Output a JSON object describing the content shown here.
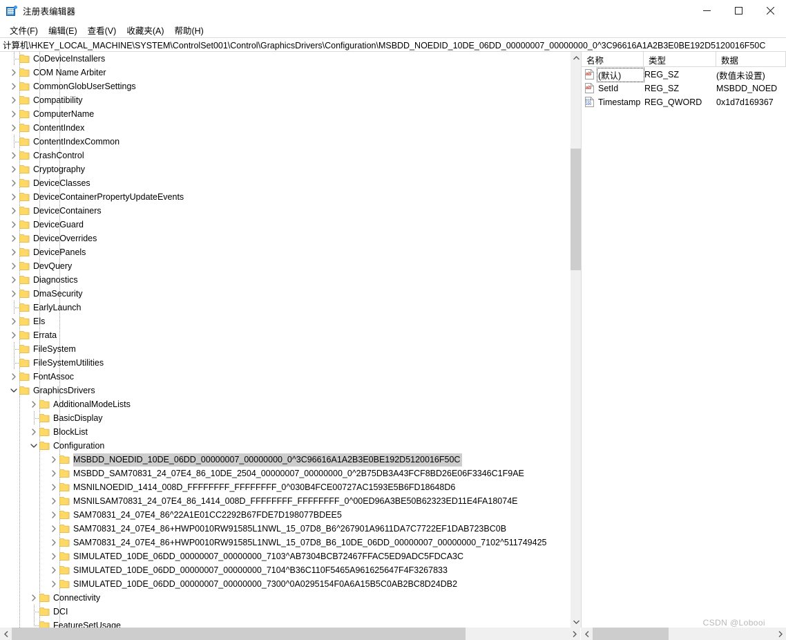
{
  "window": {
    "title": "注册表编辑器",
    "icon": "registry-editor-icon",
    "controls": {
      "minimize": "minimize-icon",
      "maximize": "maximize-icon",
      "close": "close-icon"
    }
  },
  "menubar": [
    {
      "text": "文件(F)",
      "accel": "F"
    },
    {
      "text": "编辑(E)",
      "accel": "E"
    },
    {
      "text": "查看(V)",
      "accel": "V"
    },
    {
      "text": "收藏夹(A)",
      "accel": "A"
    },
    {
      "text": "帮助(H)",
      "accel": "H"
    }
  ],
  "address": {
    "path": "计算机\\HKEY_LOCAL_MACHINE\\SYSTEM\\ControlSet001\\Control\\GraphicsDrivers\\Configuration\\MSBDD_NOEDID_10DE_06DD_00000007_00000000_0^3C96616A1A2B3E0BE192D5120016F50C"
  },
  "tree": {
    "rows": [
      {
        "label": "CoDeviceInstallers",
        "indent": 3,
        "state": "leaf"
      },
      {
        "label": "COM Name Arbiter",
        "indent": 3,
        "state": "collapsed"
      },
      {
        "label": "CommonGlobUserSettings",
        "indent": 3,
        "state": "collapsed"
      },
      {
        "label": "Compatibility",
        "indent": 3,
        "state": "collapsed"
      },
      {
        "label": "ComputerName",
        "indent": 3,
        "state": "collapsed"
      },
      {
        "label": "ContentIndex",
        "indent": 3,
        "state": "collapsed"
      },
      {
        "label": "ContentIndexCommon",
        "indent": 3,
        "state": "leaf"
      },
      {
        "label": "CrashControl",
        "indent": 3,
        "state": "collapsed"
      },
      {
        "label": "Cryptography",
        "indent": 3,
        "state": "collapsed"
      },
      {
        "label": "DeviceClasses",
        "indent": 3,
        "state": "collapsed"
      },
      {
        "label": "DeviceContainerPropertyUpdateEvents",
        "indent": 3,
        "state": "collapsed"
      },
      {
        "label": "DeviceContainers",
        "indent": 3,
        "state": "collapsed"
      },
      {
        "label": "DeviceGuard",
        "indent": 3,
        "state": "collapsed"
      },
      {
        "label": "DeviceOverrides",
        "indent": 3,
        "state": "collapsed"
      },
      {
        "label": "DevicePanels",
        "indent": 3,
        "state": "collapsed"
      },
      {
        "label": "DevQuery",
        "indent": 3,
        "state": "collapsed"
      },
      {
        "label": "Diagnostics",
        "indent": 3,
        "state": "collapsed"
      },
      {
        "label": "DmaSecurity",
        "indent": 3,
        "state": "collapsed"
      },
      {
        "label": "EarlyLaunch",
        "indent": 3,
        "state": "leaf"
      },
      {
        "label": "Els",
        "indent": 3,
        "state": "collapsed"
      },
      {
        "label": "Errata",
        "indent": 3,
        "state": "collapsed"
      },
      {
        "label": "FileSystem",
        "indent": 3,
        "state": "leaf"
      },
      {
        "label": "FileSystemUtilities",
        "indent": 3,
        "state": "leaf"
      },
      {
        "label": "FontAssoc",
        "indent": 3,
        "state": "collapsed"
      },
      {
        "label": "GraphicsDrivers",
        "indent": 3,
        "state": "expanded"
      },
      {
        "label": "AdditionalModeLists",
        "indent": 4,
        "state": "collapsed"
      },
      {
        "label": "BasicDisplay",
        "indent": 4,
        "state": "leaf"
      },
      {
        "label": "BlockList",
        "indent": 4,
        "state": "collapsed"
      },
      {
        "label": "Configuration",
        "indent": 4,
        "state": "expanded"
      },
      {
        "label": "MSBDD_NOEDID_10DE_06DD_00000007_00000000_0^3C96616A1A2B3E0BE192D5120016F50C",
        "indent": 5,
        "state": "collapsed",
        "selected": true
      },
      {
        "label": "MSBDD_SAM70831_24_07E4_86_10DE_2504_00000007_00000000_0^2B75DB3A43FCF8BD26E06F3346C1F9AE",
        "indent": 5,
        "state": "collapsed"
      },
      {
        "label": "MSNILNOEDID_1414_008D_FFFFFFFF_FFFFFFFF_0^030B4FCE00727AC1593E5B6FD18648D6",
        "indent": 5,
        "state": "collapsed"
      },
      {
        "label": "MSNILSAM70831_24_07E4_86_1414_008D_FFFFFFFF_FFFFFFFF_0^00ED96A3BE50B62323ED11E4FA18074E",
        "indent": 5,
        "state": "collapsed"
      },
      {
        "label": "SAM70831_24_07E4_86^22A1E01CC2292B67FDE7D198077BDEE5",
        "indent": 5,
        "state": "collapsed"
      },
      {
        "label": "SAM70831_24_07E4_86+HWP0010RW91585L1NWL_15_07D8_B6^267901A9611DA7C7722EF1DAB723BC0B",
        "indent": 5,
        "state": "collapsed"
      },
      {
        "label": "SAM70831_24_07E4_86+HWP0010RW91585L1NWL_15_07D8_B6_10DE_06DD_00000007_00000000_7102^511749425",
        "indent": 5,
        "state": "collapsed"
      },
      {
        "label": "SIMULATED_10DE_06DD_00000007_00000000_7103^AB7304BCB72467FFAC5ED9ADC5FDCA3C",
        "indent": 5,
        "state": "collapsed"
      },
      {
        "label": "SIMULATED_10DE_06DD_00000007_00000000_7104^B36C110F5465A961625647F4F3267833",
        "indent": 5,
        "state": "collapsed"
      },
      {
        "label": "SIMULATED_10DE_06DD_00000007_00000000_7300^0A0295154F0A6A15B5C0AB2BC8D24DB2",
        "indent": 5,
        "state": "collapsed"
      },
      {
        "label": "Connectivity",
        "indent": 4,
        "state": "collapsed"
      },
      {
        "label": "DCI",
        "indent": 4,
        "state": "leaf"
      },
      {
        "label": "FeatureSetUsage",
        "indent": 4,
        "state": "leaf"
      }
    ]
  },
  "values": {
    "columns": {
      "name": "名称",
      "type": "类型",
      "data": "数据"
    },
    "rows": [
      {
        "icon": "string-value-icon",
        "name": "(默认)",
        "type": "REG_SZ",
        "data": "(数值未设置)",
        "focused": true
      },
      {
        "icon": "string-value-icon",
        "name": "SetId",
        "type": "REG_SZ",
        "data": "MSBDD_NOED"
      },
      {
        "icon": "binary-value-icon",
        "name": "Timestamp",
        "type": "REG_QWORD",
        "data": "0x1d7d169367"
      }
    ]
  },
  "watermark": {
    "text": "CSDN @Lobooi"
  },
  "colors": {
    "selection": "#cdcdcd",
    "folder": "#ffd966",
    "scrollbar_track": "#f0f0f0",
    "scrollbar_thumb": "#cdcdcd",
    "icon_blue": "#2c7fd4"
  }
}
